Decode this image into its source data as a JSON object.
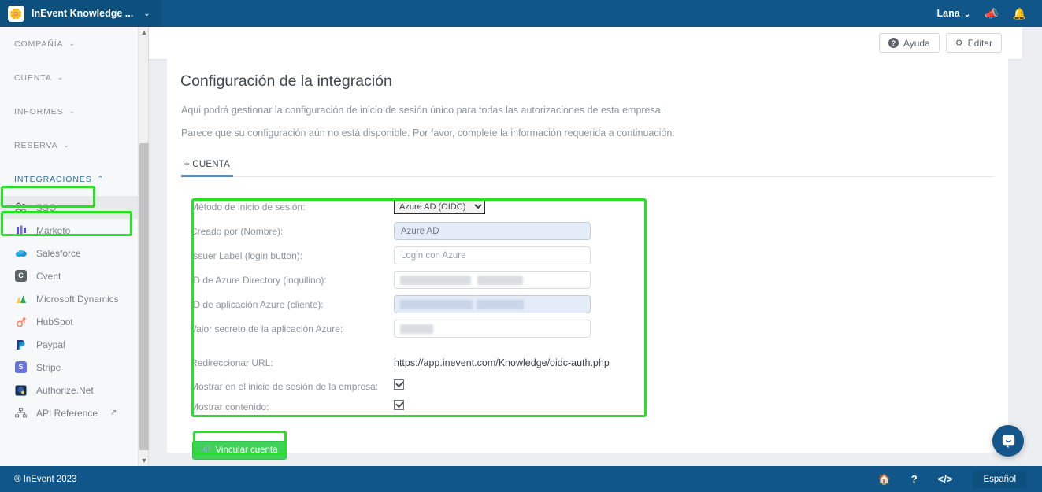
{
  "topbar": {
    "brand_name": "InEvent Knowledge ...",
    "brand_caret": "⌄",
    "logo_glyph": "🌼",
    "user_name": "Lana",
    "user_caret": "⌄",
    "megaphone_icon": "📣",
    "bell_icon": "🔔"
  },
  "sidebar": {
    "groups": [
      {
        "label": "COMPAÑÍA",
        "caret": "⌄"
      },
      {
        "label": "CUENTA",
        "caret": "⌄"
      },
      {
        "label": "INFORMES",
        "caret": "⌄"
      },
      {
        "label": "RESERVA",
        "caret": "⌄"
      },
      {
        "label": "INTEGRACIONES",
        "caret": "⌃"
      }
    ],
    "items": [
      {
        "label": "SSO",
        "icon": "👥"
      },
      {
        "label": "Marketo",
        "icon": "‖"
      },
      {
        "label": "Salesforce",
        "icon": "☁"
      },
      {
        "label": "Cvent",
        "icon": "C"
      },
      {
        "label": "Microsoft Dynamics",
        "icon": "📊"
      },
      {
        "label": "HubSpot",
        "icon": "✿"
      },
      {
        "label": "Paypal",
        "icon": "P"
      },
      {
        "label": "Stripe",
        "icon": "S"
      },
      {
        "label": "Authorize.Net",
        "icon": "◉"
      },
      {
        "label": "API Reference",
        "icon": "⛓",
        "external": "↗"
      }
    ]
  },
  "toolbar": {
    "help_label": "Ayuda",
    "help_icon": "?",
    "edit_label": "Editar",
    "edit_icon": "⚙"
  },
  "page": {
    "title": "Configuración de la integración",
    "desc1": "Aqui podrá gestionar la configuración de inicio de sesión único para todas las autorizaciones de esta empresa.",
    "desc2": "Parece que su configuración aún no está disponible. Por favor, complete la información requerida a continuación:"
  },
  "tabs": [
    {
      "label": "+ CUENTA",
      "active": true
    }
  ],
  "form": {
    "method": {
      "label": "Método de inicio de sesión:",
      "value": "Azure AD (OIDC)",
      "options": [
        "Azure AD (OIDC)"
      ]
    },
    "created_by": {
      "label": "Creado por (Nombre):",
      "value": "Azure AD"
    },
    "issuer_label": {
      "label": "Issuer Label (login button):",
      "value": "",
      "placeholder": "Login con Azure"
    },
    "directory_id": {
      "label": "ID de Azure Directory (inquilino):",
      "value": ""
    },
    "application_id": {
      "label": "ID de aplicación Azure (cliente):",
      "value": ""
    },
    "secret_value": {
      "label": "Valor secreto de la aplicación Azure:",
      "value": ""
    },
    "redirect_url": {
      "label": "Redireccionar URL:",
      "value": "https://app.inevent.com/Knowledge/oidc-auth.php"
    },
    "show_company_login": {
      "label": "Mostrar en el inicio de sesión de la empresa:",
      "checked": true
    },
    "show_content": {
      "label": "Mostrar contenido:",
      "checked": true
    },
    "submit": {
      "label": "Vincular cuenta",
      "icon": "🔗"
    }
  },
  "footer": {
    "copyright": "® InEvent 2023",
    "home_icon": "🏠",
    "help_icon": "?",
    "code_icon": "</>",
    "language": "Español"
  },
  "chat": {
    "icon": "💬"
  },
  "colors": {
    "brand_blue": "#115688",
    "highlight_green": "#25e225",
    "submit_green": "#3fd15a",
    "tab_underline": "#5b8db8"
  }
}
